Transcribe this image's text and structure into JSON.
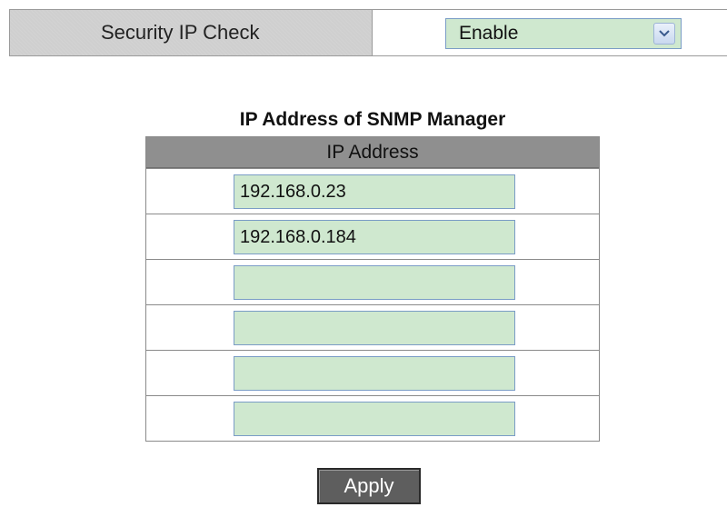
{
  "security": {
    "label": "Security IP Check",
    "select_value": "Enable",
    "arrow_icon": "chevron-down-icon"
  },
  "manager": {
    "title": "IP Address of SNMP Manager",
    "column_header": "IP Address",
    "entries": [
      {
        "value": "192.168.0.23"
      },
      {
        "value": "192.168.0.184"
      },
      {
        "value": ""
      },
      {
        "value": ""
      },
      {
        "value": ""
      },
      {
        "value": ""
      }
    ]
  },
  "actions": {
    "apply_label": "Apply"
  },
  "colors": {
    "label_bg": "#cfcfcf",
    "input_bg": "#cfe8cf",
    "input_border": "#7a9cc6",
    "header_bg": "#8f8f8f",
    "button_bg": "#5e5e5e"
  }
}
